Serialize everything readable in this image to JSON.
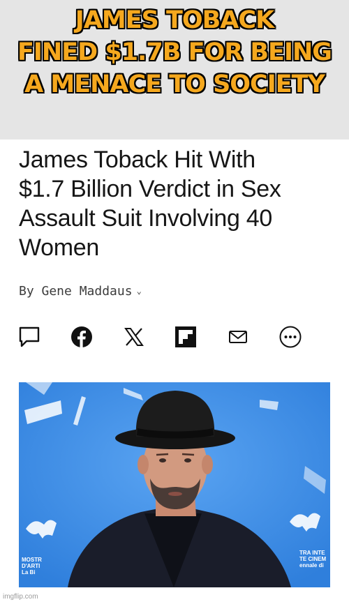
{
  "meme": {
    "caption_lines": [
      "JAMES TOBACK",
      "FINED $1.7B FOR BEING",
      "A MENACE TO SOCIETY"
    ]
  },
  "article": {
    "headline_lines": [
      "James Toback Hit With",
      "$1.7 Billion Verdict in Sex",
      "Assault Suit Involving 40",
      "Women"
    ],
    "byline": "By Gene Maddaus",
    "share_icons": [
      "comment-icon",
      "facebook-icon",
      "x-icon",
      "flipboard-icon",
      "email-icon",
      "more-icon"
    ]
  },
  "photo": {
    "logo_left_lines": [
      "MOSTR",
      "D'ARTI",
      "La Bi"
    ],
    "logo_right_lines": [
      "TRA INTE",
      "TE CINEM",
      "ennale di"
    ]
  },
  "footer": {
    "watermark": "imgflip.com"
  },
  "colors": {
    "banner": "#e5e5e5",
    "caption": "#f5a81e",
    "photo_bg": "#3d8fe8"
  }
}
